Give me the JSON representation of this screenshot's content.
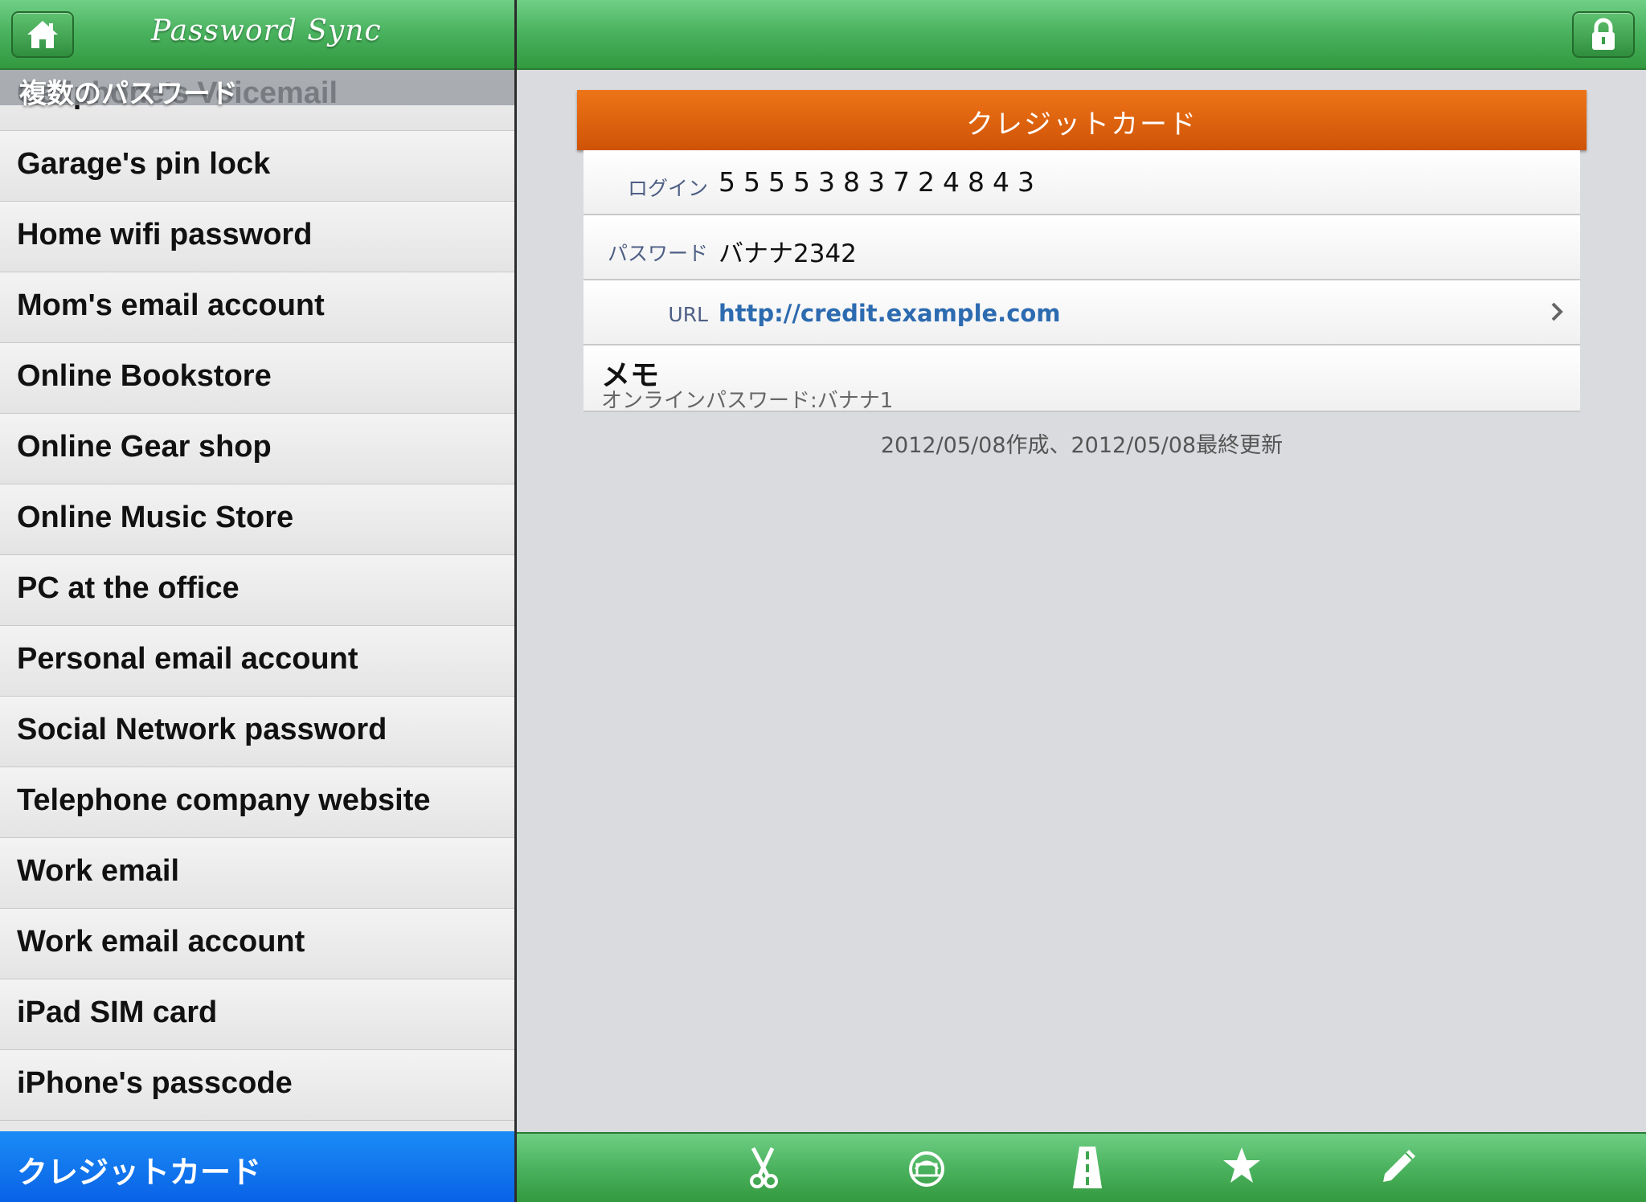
{
  "app": {
    "title": "Password Sync"
  },
  "sidebar": {
    "section_header": "複数のパスワード",
    "items": [
      {
        "label": "Cellphone's Voicemail"
      },
      {
        "label": "Garage's pin lock"
      },
      {
        "label": "Home wifi password"
      },
      {
        "label": "Mom's email account"
      },
      {
        "label": "Online Bookstore"
      },
      {
        "label": "Online Gear shop"
      },
      {
        "label": "Online Music Store"
      },
      {
        "label": "PC at the office"
      },
      {
        "label": "Personal email account"
      },
      {
        "label": "Social Network password"
      },
      {
        "label": "Telephone company website"
      },
      {
        "label": "Work email"
      },
      {
        "label": "Work email account"
      },
      {
        "label": "iPad SIM card"
      },
      {
        "label": "iPhone's passcode"
      },
      {
        "label": "クレジットカード",
        "selected": true
      }
    ]
  },
  "detail": {
    "title": "クレジットカード",
    "login_label": "ログイン",
    "login_value": "5555383724843",
    "password_label": "パスワード",
    "password_value": "バナナ2342",
    "url_label": "URL",
    "url_value": "http://credit.example.com",
    "memo_title": "メモ",
    "memo_text": "オンラインパスワード:バナナ1",
    "timestamps": "2012/05/08作成、2012/05/08最終更新"
  },
  "toolbar": {
    "icons": [
      "scissors-icon",
      "sync-icon",
      "road-icon",
      "star-icon",
      "pencil-icon"
    ]
  },
  "colors": {
    "nav_green": "#49b25e",
    "header_orange": "#e0630e",
    "selection_blue": "#0a6cf0",
    "link_blue": "#2d6bb0",
    "label_blue": "#4e5f85"
  }
}
